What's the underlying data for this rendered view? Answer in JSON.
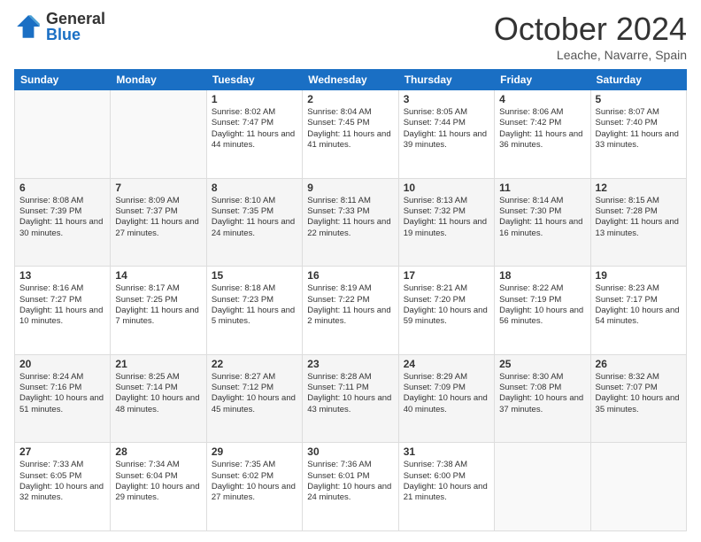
{
  "header": {
    "logo_general": "General",
    "logo_blue": "Blue",
    "month_title": "October 2024",
    "location": "Leache, Navarre, Spain"
  },
  "days_of_week": [
    "Sunday",
    "Monday",
    "Tuesday",
    "Wednesday",
    "Thursday",
    "Friday",
    "Saturday"
  ],
  "weeks": [
    [
      {
        "day": "",
        "info": ""
      },
      {
        "day": "",
        "info": ""
      },
      {
        "day": "1",
        "info": "Sunrise: 8:02 AM\nSunset: 7:47 PM\nDaylight: 11 hours and 44 minutes."
      },
      {
        "day": "2",
        "info": "Sunrise: 8:04 AM\nSunset: 7:45 PM\nDaylight: 11 hours and 41 minutes."
      },
      {
        "day": "3",
        "info": "Sunrise: 8:05 AM\nSunset: 7:44 PM\nDaylight: 11 hours and 39 minutes."
      },
      {
        "day": "4",
        "info": "Sunrise: 8:06 AM\nSunset: 7:42 PM\nDaylight: 11 hours and 36 minutes."
      },
      {
        "day": "5",
        "info": "Sunrise: 8:07 AM\nSunset: 7:40 PM\nDaylight: 11 hours and 33 minutes."
      }
    ],
    [
      {
        "day": "6",
        "info": "Sunrise: 8:08 AM\nSunset: 7:39 PM\nDaylight: 11 hours and 30 minutes."
      },
      {
        "day": "7",
        "info": "Sunrise: 8:09 AM\nSunset: 7:37 PM\nDaylight: 11 hours and 27 minutes."
      },
      {
        "day": "8",
        "info": "Sunrise: 8:10 AM\nSunset: 7:35 PM\nDaylight: 11 hours and 24 minutes."
      },
      {
        "day": "9",
        "info": "Sunrise: 8:11 AM\nSunset: 7:33 PM\nDaylight: 11 hours and 22 minutes."
      },
      {
        "day": "10",
        "info": "Sunrise: 8:13 AM\nSunset: 7:32 PM\nDaylight: 11 hours and 19 minutes."
      },
      {
        "day": "11",
        "info": "Sunrise: 8:14 AM\nSunset: 7:30 PM\nDaylight: 11 hours and 16 minutes."
      },
      {
        "day": "12",
        "info": "Sunrise: 8:15 AM\nSunset: 7:28 PM\nDaylight: 11 hours and 13 minutes."
      }
    ],
    [
      {
        "day": "13",
        "info": "Sunrise: 8:16 AM\nSunset: 7:27 PM\nDaylight: 11 hours and 10 minutes."
      },
      {
        "day": "14",
        "info": "Sunrise: 8:17 AM\nSunset: 7:25 PM\nDaylight: 11 hours and 7 minutes."
      },
      {
        "day": "15",
        "info": "Sunrise: 8:18 AM\nSunset: 7:23 PM\nDaylight: 11 hours and 5 minutes."
      },
      {
        "day": "16",
        "info": "Sunrise: 8:19 AM\nSunset: 7:22 PM\nDaylight: 11 hours and 2 minutes."
      },
      {
        "day": "17",
        "info": "Sunrise: 8:21 AM\nSunset: 7:20 PM\nDaylight: 10 hours and 59 minutes."
      },
      {
        "day": "18",
        "info": "Sunrise: 8:22 AM\nSunset: 7:19 PM\nDaylight: 10 hours and 56 minutes."
      },
      {
        "day": "19",
        "info": "Sunrise: 8:23 AM\nSunset: 7:17 PM\nDaylight: 10 hours and 54 minutes."
      }
    ],
    [
      {
        "day": "20",
        "info": "Sunrise: 8:24 AM\nSunset: 7:16 PM\nDaylight: 10 hours and 51 minutes."
      },
      {
        "day": "21",
        "info": "Sunrise: 8:25 AM\nSunset: 7:14 PM\nDaylight: 10 hours and 48 minutes."
      },
      {
        "day": "22",
        "info": "Sunrise: 8:27 AM\nSunset: 7:12 PM\nDaylight: 10 hours and 45 minutes."
      },
      {
        "day": "23",
        "info": "Sunrise: 8:28 AM\nSunset: 7:11 PM\nDaylight: 10 hours and 43 minutes."
      },
      {
        "day": "24",
        "info": "Sunrise: 8:29 AM\nSunset: 7:09 PM\nDaylight: 10 hours and 40 minutes."
      },
      {
        "day": "25",
        "info": "Sunrise: 8:30 AM\nSunset: 7:08 PM\nDaylight: 10 hours and 37 minutes."
      },
      {
        "day": "26",
        "info": "Sunrise: 8:32 AM\nSunset: 7:07 PM\nDaylight: 10 hours and 35 minutes."
      }
    ],
    [
      {
        "day": "27",
        "info": "Sunrise: 7:33 AM\nSunset: 6:05 PM\nDaylight: 10 hours and 32 minutes."
      },
      {
        "day": "28",
        "info": "Sunrise: 7:34 AM\nSunset: 6:04 PM\nDaylight: 10 hours and 29 minutes."
      },
      {
        "day": "29",
        "info": "Sunrise: 7:35 AM\nSunset: 6:02 PM\nDaylight: 10 hours and 27 minutes."
      },
      {
        "day": "30",
        "info": "Sunrise: 7:36 AM\nSunset: 6:01 PM\nDaylight: 10 hours and 24 minutes."
      },
      {
        "day": "31",
        "info": "Sunrise: 7:38 AM\nSunset: 6:00 PM\nDaylight: 10 hours and 21 minutes."
      },
      {
        "day": "",
        "info": ""
      },
      {
        "day": "",
        "info": ""
      }
    ]
  ]
}
